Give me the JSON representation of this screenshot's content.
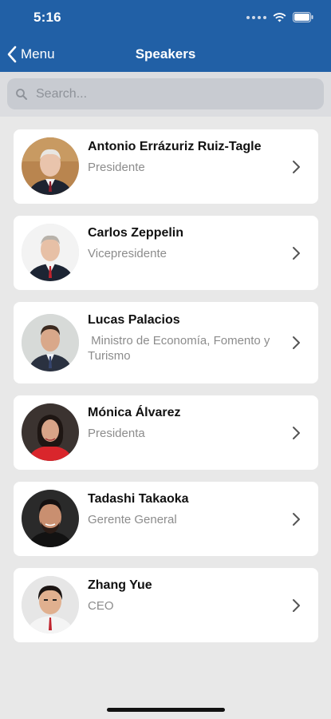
{
  "status": {
    "time": "5:16"
  },
  "nav": {
    "back_label": "Menu",
    "title": "Speakers"
  },
  "search": {
    "placeholder": "Search..."
  },
  "speakers": [
    {
      "name": "Antonio Errázuriz Ruiz-Tagle",
      "role": "Presidente"
    },
    {
      "name": "Carlos Zeppelin",
      "role": "Vicepresidente"
    },
    {
      "name": "Lucas Palacios",
      "role": " Ministro de Economía, Fomento y Turismo"
    },
    {
      "name": "Mónica Álvarez",
      "role": "Presidenta"
    },
    {
      "name": "Tadashi Takaoka",
      "role": "Gerente General"
    },
    {
      "name": "Zhang Yue",
      "role": "CEO"
    }
  ],
  "colors": {
    "nav_bg": "#2160a6",
    "page_bg": "#e8e8e8",
    "card_bg": "#ffffff",
    "role_text": "#8c8c8c"
  }
}
